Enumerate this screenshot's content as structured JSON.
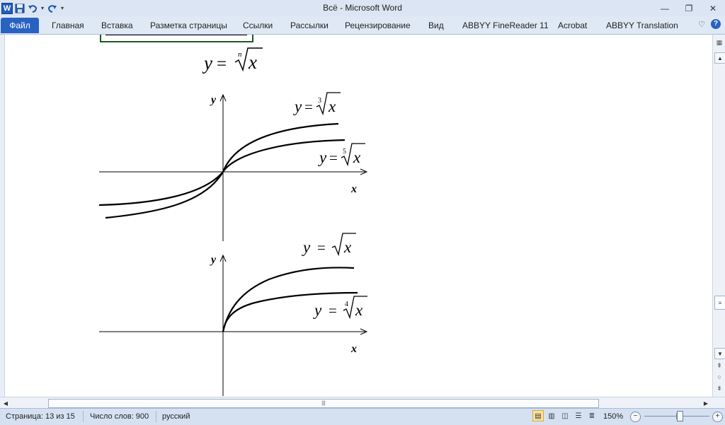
{
  "window": {
    "title": "Всё  -  Microsoft Word",
    "controls": {
      "minimize": "—",
      "restore": "❐",
      "close": "✕"
    }
  },
  "quick_access": {
    "app_icon": "W",
    "save_icon": "floppy-disk-icon",
    "undo_icon": "undo-icon",
    "redo_icon": "redo-icon",
    "customize_icon": "customize-arrow-icon"
  },
  "ribbon": {
    "file_tab": "Файл",
    "tabs": [
      "Главная",
      "Вставка",
      "Разметка страницы",
      "Ссылки",
      "Рассылки",
      "Рецензирование",
      "Вид",
      "ABBYY FineReader 11",
      "Acrobat",
      "ABBYY Translation"
    ],
    "help_icon": "?",
    "collapse_icon": "♡"
  },
  "document": {
    "formula_main": {
      "lhs": "y",
      "eq": "=",
      "index": "n",
      "radicand": "x"
    },
    "graph1": {
      "label_top": {
        "lhs": "y",
        "eq": "=",
        "index": "3",
        "radicand": "x"
      },
      "label_bottom": {
        "lhs": "y",
        "eq": "=",
        "index": "5",
        "radicand": "x"
      },
      "axis_x": "x",
      "axis_y": "y"
    },
    "graph2": {
      "label_top": {
        "lhs": "y",
        "eq": "=",
        "index": "",
        "radicand": "x"
      },
      "label_bottom": {
        "lhs": "y",
        "eq": "=",
        "index": "4",
        "radicand": "x"
      },
      "axis_x": "x",
      "axis_y": "y"
    }
  },
  "statusbar": {
    "page": "Страница: 13 из 15",
    "words": "Число слов: 900",
    "language": "русский",
    "zoom": "150%",
    "zoom_level_percent": 150
  }
}
